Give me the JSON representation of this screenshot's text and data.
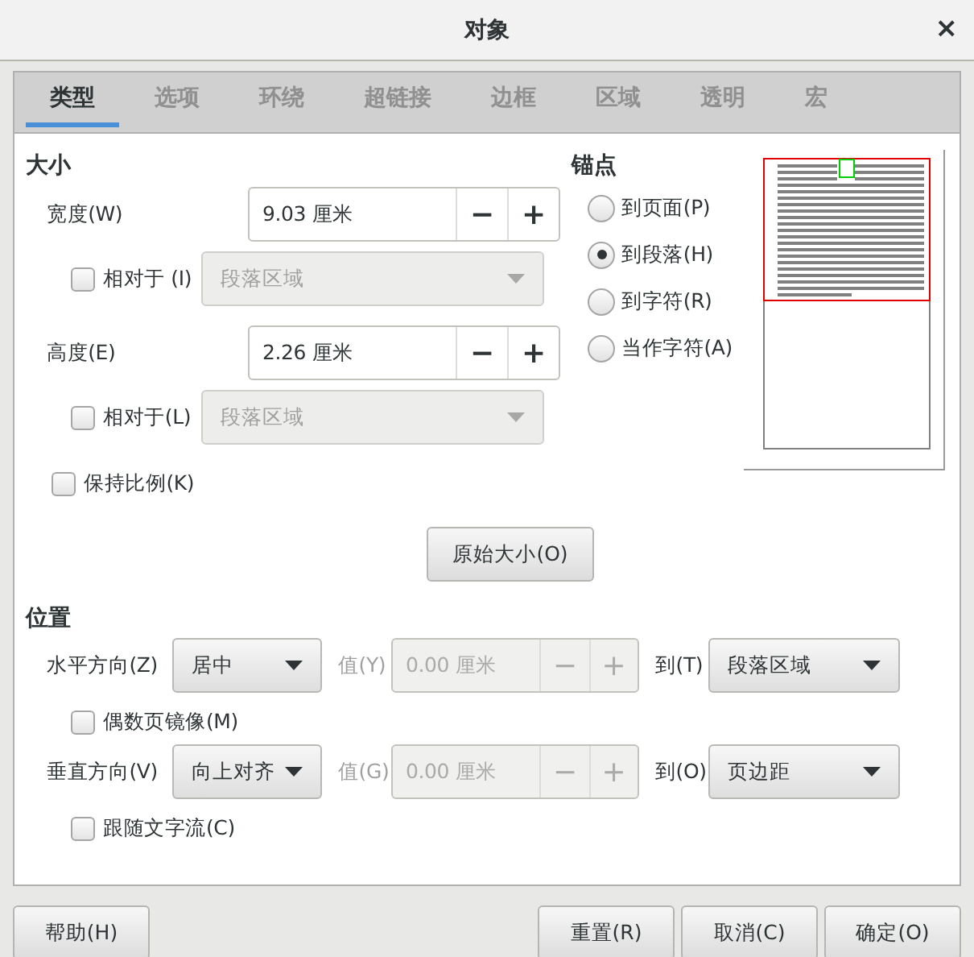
{
  "window": {
    "title": "对象",
    "close": "×"
  },
  "tabs": [
    {
      "label": "类型",
      "selected": true
    },
    {
      "label": "选项",
      "selected": false
    },
    {
      "label": "环绕",
      "selected": false
    },
    {
      "label": "超链接",
      "selected": false
    },
    {
      "label": "边框",
      "selected": false
    },
    {
      "label": "区域",
      "selected": false
    },
    {
      "label": "透明",
      "selected": false
    },
    {
      "label": "宏",
      "selected": false
    }
  ],
  "size": {
    "heading": "大小",
    "rows": [
      {
        "kind": "spin",
        "label": "宽度(W)",
        "value": "9.03 厘米",
        "decrement": "−",
        "increment": "+"
      },
      {
        "kind": "relative",
        "label": "相对于 (I)",
        "checked": false,
        "combo": "段落区域",
        "combo_disabled": true
      },
      {
        "kind": "spin",
        "label": "高度(E)",
        "value": "2.26 厘米",
        "decrement": "−",
        "increment": "+"
      },
      {
        "kind": "relative",
        "label": "相对于(L)",
        "checked": false,
        "combo": "段落区域",
        "combo_disabled": true
      },
      {
        "kind": "check",
        "label": "保持比例(K)",
        "checked": false
      }
    ]
  },
  "anchor": {
    "heading": "锚点",
    "options": [
      {
        "label": "到页面(P)",
        "selected": false
      },
      {
        "label": "到段落(H)",
        "selected": true
      },
      {
        "label": "到字符(R)",
        "selected": false
      },
      {
        "label": "当作字符(A)",
        "selected": false
      }
    ]
  },
  "original_size_button": "原始大小(O)",
  "position": {
    "heading": "位置",
    "rows": [
      {
        "kind": "axis",
        "label": "水平方向(Z)",
        "combo": "居中",
        "value_label": "值(Y)",
        "value": "0.00 厘米",
        "decrement": "−",
        "increment": "+",
        "value_disabled": true,
        "to_label": "到(T)",
        "to_combo": "段落区域"
      },
      {
        "kind": "check",
        "label": "偶数页镜像(M)",
        "checked": false
      },
      {
        "kind": "axis",
        "label": "垂直方向(V)",
        "combo": "向上对齐",
        "value_label": "值(G)",
        "value": "0.00 厘米",
        "decrement": "−",
        "increment": "+",
        "value_disabled": true,
        "to_label": "到(O)",
        "to_combo": "页边距"
      },
      {
        "kind": "check",
        "label": "跟随文字流(C)",
        "checked": false
      }
    ]
  },
  "buttons_left": [
    "帮助(H)"
  ],
  "buttons_right": [
    "重置(R)",
    "取消(C)",
    "确定(O)"
  ]
}
